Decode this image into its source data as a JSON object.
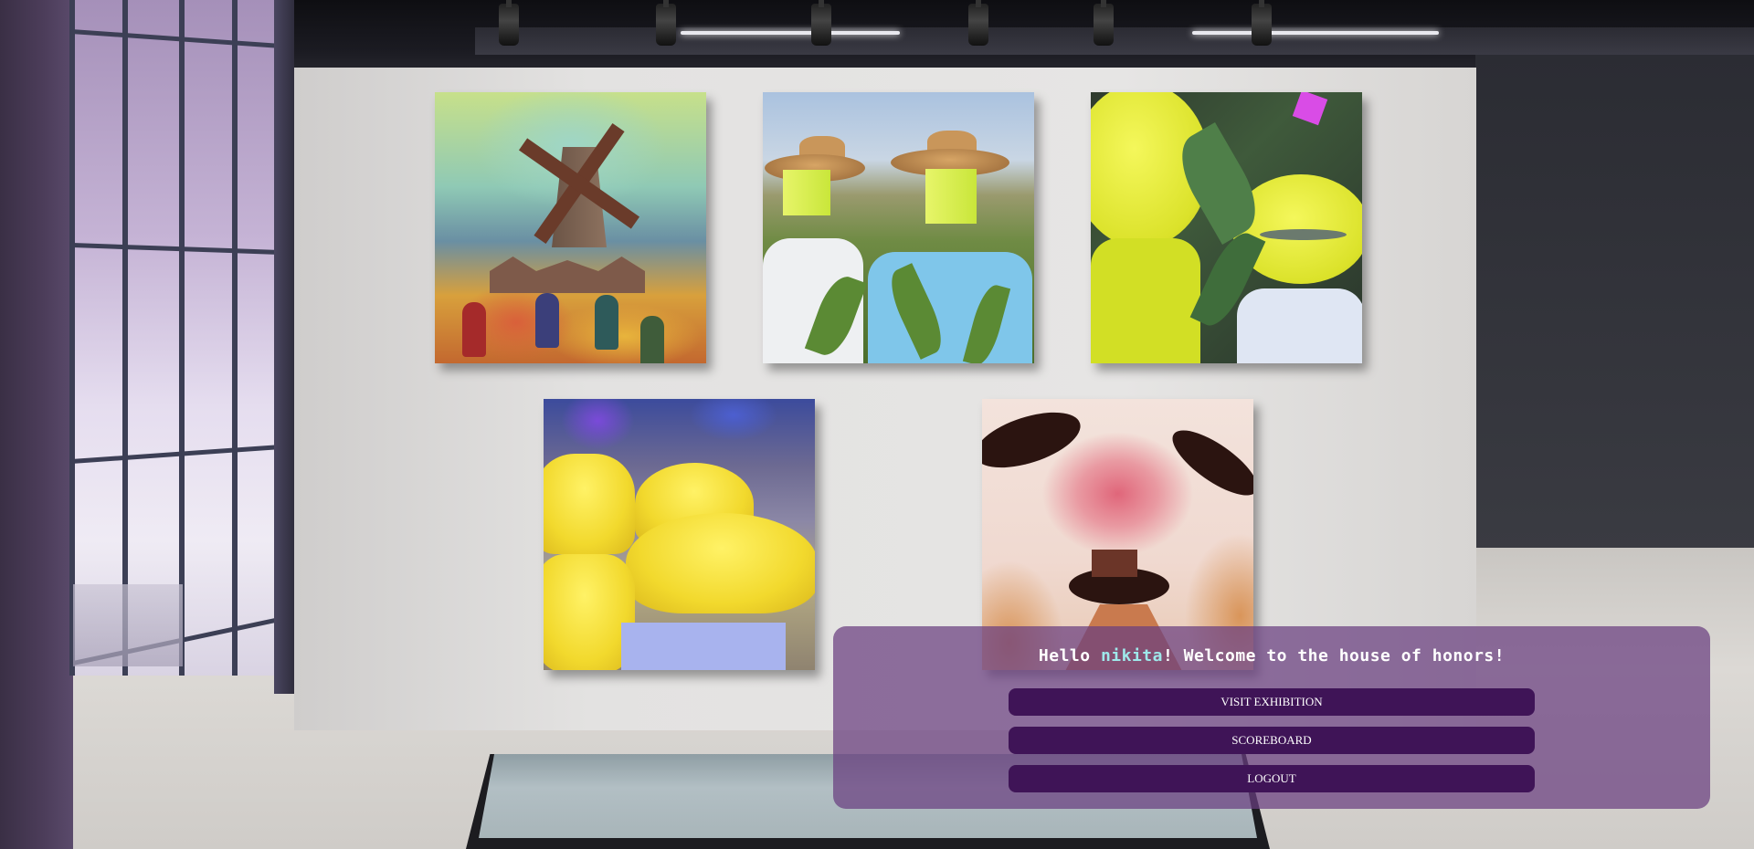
{
  "app": {
    "title": "house of honors"
  },
  "welcome": {
    "prefix": "Hello ",
    "username": "nikita",
    "suffix": "! Welcome to the house of honors!"
  },
  "menu": {
    "visit_label": "VISIT EXHIBITION",
    "scoreboard_label": "SCOREBOARD",
    "logout_label": "LOGOUT"
  },
  "colors": {
    "panel": "#6a3e80",
    "button": "#3f1457",
    "username": "#9ee8ea"
  },
  "artworks": [
    {
      "subject": "windmill-painting"
    },
    {
      "subject": "straw-hats-cornfield-photo"
    },
    {
      "subject": "yellow-hats-foliage"
    },
    {
      "subject": "yellow-hats-impressionist"
    },
    {
      "subject": "black-hats-watercolor"
    }
  ]
}
